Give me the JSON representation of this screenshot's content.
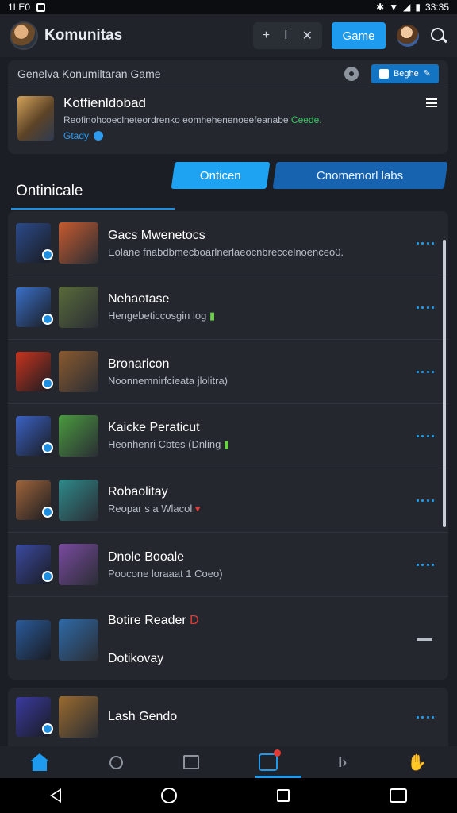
{
  "status": {
    "time_left": "1LE0",
    "time_right": "33:35"
  },
  "app": {
    "title": "Komunitas",
    "game_button": "Game",
    "tool_plus": "+",
    "tool_sep": "I",
    "tool_close": "✕"
  },
  "featured": {
    "header": "Genelva Konumiltaran Game",
    "badge_label": "Beghe",
    "title": "Kotfienldobad",
    "desc": "Reofinohcoeclneteordrenko eomhehenenoeefeanabe",
    "desc_highlight": "Ceede.",
    "meta": "Gtady"
  },
  "tabs": {
    "section_title": "Ontinicale",
    "online": "Onticen",
    "community": "Cnomemorl labs"
  },
  "rows": [
    {
      "title": "Gacs Mwenetocs",
      "sub": "Eolane fnabdbmecboarlnerlaeocnbreccelnoenceo0.",
      "accent": "",
      "colors": [
        "#2b4a8a",
        "#c65a2e"
      ]
    },
    {
      "title": "Nehaotase",
      "sub": "Hengebeticcosgin log",
      "accent": "▮",
      "accent_class": "green",
      "colors": [
        "#3a70c8",
        "#5a6b3a"
      ]
    },
    {
      "title": "Bronaricon",
      "sub": "Noonnemnirfcieata jlolitra)",
      "accent": "",
      "colors": [
        "#c8341e",
        "#8a5a2e"
      ]
    },
    {
      "title": "Kaicke Peraticut",
      "sub": "Heonhenri Cbtes (Dnling",
      "accent": "▮",
      "accent_class": "green",
      "colors": [
        "#3b62c4",
        "#4a9a3e"
      ]
    },
    {
      "title": "Robaolitay",
      "sub": "Reopar s a Wlacol",
      "accent": "▾",
      "accent_class": "red",
      "colors": [
        "#a0643a",
        "#2e8a8a"
      ]
    },
    {
      "title": "Dnole Booale",
      "sub": "Poocone loraaat 1 Coeo)",
      "accent": "",
      "colors": [
        "#3a4aa0",
        "#7a4aa0"
      ]
    }
  ],
  "tall_row": {
    "title": "Botire Reader",
    "title_tag": "D",
    "sub": "Dotikovay",
    "colors": [
      "#2a5a9a",
      "#2e6aa8"
    ]
  },
  "last_row": {
    "title": "Lash Gendo",
    "colors": [
      "#3a3aa0",
      "#9a6a2e"
    ]
  },
  "nav": {
    "play": "I›",
    "hand": "✋"
  }
}
